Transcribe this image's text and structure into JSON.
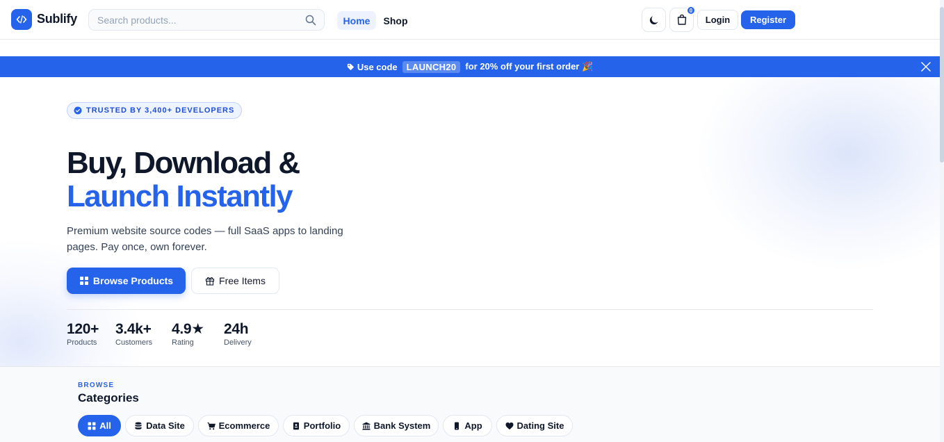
{
  "header": {
    "logo_text": "Sublify",
    "search_placeholder": "Search products...",
    "nav": [
      {
        "label": "Home",
        "active": true
      },
      {
        "label": "Shop",
        "active": false
      }
    ],
    "cart_count": "0",
    "login_label": "Login",
    "register_label": "Register"
  },
  "promo": {
    "prefix": "Use code",
    "code": "LAUNCH20",
    "suffix": "for 20% off your first order 🎉"
  },
  "hero": {
    "badge": "TRUSTED BY 3,400+ DEVELOPERS",
    "title_line1": "Buy, Download &",
    "title_line2": "Launch Instantly",
    "subtitle": "Premium website source codes — full SaaS apps to landing pages. Pay once, own forever.",
    "primary_button": "Browse Products",
    "secondary_button": "Free Items",
    "stats": [
      {
        "value": "120+",
        "label": "Products"
      },
      {
        "value": "3.4k+",
        "label": "Customers"
      },
      {
        "value": "4.9★",
        "label": "Rating"
      },
      {
        "value": "24h",
        "label": "Delivery"
      }
    ]
  },
  "categories": {
    "eyebrow": "BROWSE",
    "title": "Categories",
    "items": [
      {
        "label": "All",
        "icon": "grid-icon",
        "active": true
      },
      {
        "label": "Data Site",
        "icon": "database-icon",
        "active": false
      },
      {
        "label": "Ecommerce",
        "icon": "cart-icon",
        "active": false
      },
      {
        "label": "Portfolio",
        "icon": "portfolio-icon",
        "active": false
      },
      {
        "label": "Bank System",
        "icon": "bank-icon",
        "active": false
      },
      {
        "label": "App",
        "icon": "phone-icon",
        "active": false
      },
      {
        "label": "Dating Site",
        "icon": "heart-icon",
        "active": false
      }
    ]
  },
  "colors": {
    "accent": "#2563eb",
    "text": "#0f172a",
    "muted": "#475569"
  }
}
